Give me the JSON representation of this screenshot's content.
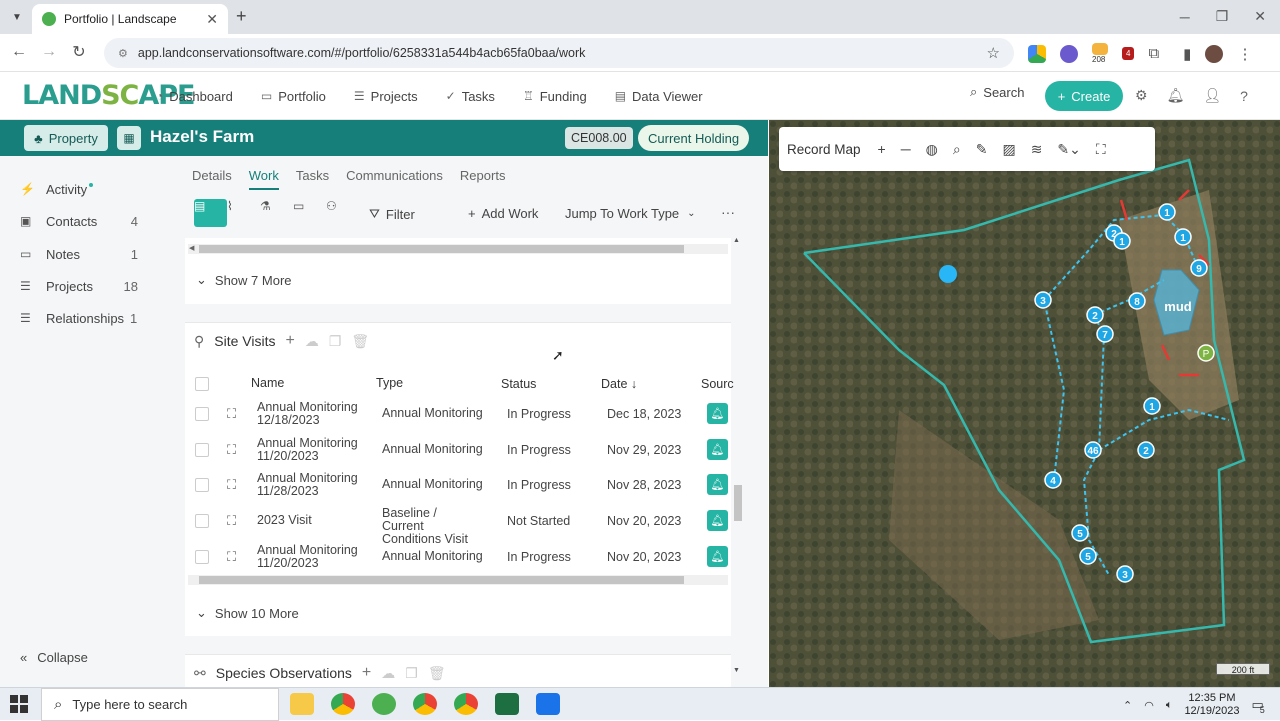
{
  "browser": {
    "tab_title": "Portfolio | Landscape",
    "url": "app.landconservationsoftware.com/#/portfolio/6258331a544b4acb65fa0baa/work",
    "ext_badge_1": "208",
    "ext_badge_2": "4"
  },
  "app": {
    "logo_left": "LAND",
    "logo_c": "SC",
    "logo_right": "APE",
    "nav": [
      {
        "label": "Dashboard",
        "icon": "dashboard-icon"
      },
      {
        "label": "Portfolio",
        "icon": "folder-icon"
      },
      {
        "label": "Projects",
        "icon": "projects-icon"
      },
      {
        "label": "Tasks",
        "icon": "check-icon"
      },
      {
        "label": "Funding",
        "icon": "funding-icon"
      },
      {
        "label": "Data Viewer",
        "icon": "document-icon"
      }
    ],
    "search_label": "Search",
    "create_label": "Create"
  },
  "property": {
    "type_label": "Property",
    "name": "Hazel's Farm",
    "code": "CE008.00",
    "status": "Current Holding"
  },
  "sidebar": {
    "items": [
      {
        "label": "Activity",
        "count": ""
      },
      {
        "label": "Contacts",
        "count": "4"
      },
      {
        "label": "Notes",
        "count": "1"
      },
      {
        "label": "Projects",
        "count": "18"
      },
      {
        "label": "Relationships",
        "count": "1"
      }
    ],
    "collapse_label": "Collapse"
  },
  "work": {
    "tabs": [
      "Details",
      "Work",
      "Tasks",
      "Communications",
      "Reports"
    ],
    "active_tab": "Work",
    "filter_label": "Filter",
    "add_work_label": "Add Work",
    "jump_label": "Jump To Work Type",
    "prev_show_more": "Show 7 More",
    "site_visits": {
      "title": "Site Visits",
      "columns": [
        "Name",
        "Type",
        "Status",
        "Date",
        "Sourc"
      ],
      "rows": [
        {
          "name": "Annual Monitoring 12/18/2023",
          "type": "Annual Monitoring",
          "status": "In Progress",
          "date": "Dec 18, 2023"
        },
        {
          "name": "Annual Monitoring 11/20/2023",
          "type": "Annual Monitoring",
          "status": "In Progress",
          "date": "Nov 29, 2023"
        },
        {
          "name": "Annual Monitoring 11/28/2023",
          "type": "Annual Monitoring",
          "status": "In Progress",
          "date": "Nov 28, 2023"
        },
        {
          "name": "2023 Visit",
          "type": "Baseline / Current Conditions Visit",
          "status": "Not Started",
          "date": "Nov 20, 2023"
        },
        {
          "name": "Annual Monitoring 11/20/2023",
          "type": "Annual Monitoring",
          "status": "In Progress",
          "date": "Nov 20, 2023"
        }
      ],
      "show_more": "Show 10 More"
    },
    "species_title": "Species Observations"
  },
  "map": {
    "title": "Record Map",
    "scale": "200 ft",
    "area_label": "mud",
    "markers": [
      "1",
      "2",
      "1",
      "1",
      "9",
      "3",
      "2",
      "8",
      "7",
      "1",
      "46",
      "2",
      "4",
      "5",
      "5",
      "3"
    ],
    "p_label": "P"
  },
  "taskbar": {
    "search_placeholder": "Type here to search",
    "time": "12:35 PM",
    "date": "12/19/2023",
    "notif_count": "5"
  },
  "colors": {
    "teal": "#167f7a",
    "accent": "#26b5a4",
    "logo_green": "#7cb342"
  }
}
